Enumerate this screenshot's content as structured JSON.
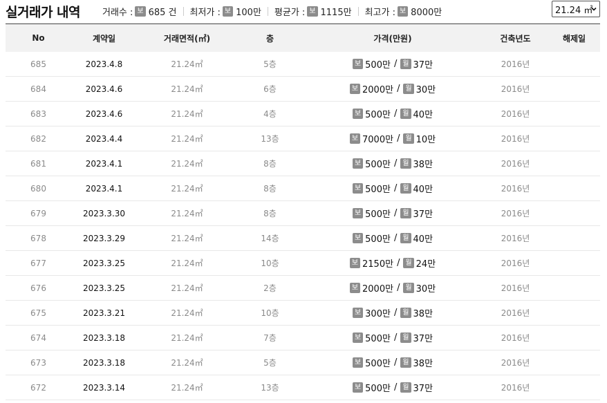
{
  "header": {
    "title": "실거래가 내역",
    "stats": [
      {
        "label": "거래수 :",
        "badge": "보",
        "value": "685 건"
      },
      {
        "label": "최저가 :",
        "badge": "보",
        "value": "100만"
      },
      {
        "label": "평균가 :",
        "badge": "보",
        "value": "1115만"
      },
      {
        "label": "최고가 :",
        "badge": "보",
        "value": "8000만"
      }
    ],
    "area_select": {
      "selected": "21.24 ㎡"
    }
  },
  "table": {
    "columns": [
      "No",
      "계약일",
      "거래면적(㎡)",
      "층",
      "가격(만원)",
      "건축년도",
      "해제일"
    ],
    "deposit_badge": "보",
    "monthly_badge": "월",
    "rows": [
      {
        "no": "685",
        "date": "2023.4.8",
        "area": "21.24㎡",
        "floor": "5층",
        "deposit": "500만",
        "monthly": "37만",
        "year": "2016년",
        "cancel": ""
      },
      {
        "no": "684",
        "date": "2023.4.6",
        "area": "21.24㎡",
        "floor": "6층",
        "deposit": "2000만",
        "monthly": "30만",
        "year": "2016년",
        "cancel": ""
      },
      {
        "no": "683",
        "date": "2023.4.6",
        "area": "21.24㎡",
        "floor": "4층",
        "deposit": "500만",
        "monthly": "40만",
        "year": "2016년",
        "cancel": ""
      },
      {
        "no": "682",
        "date": "2023.4.4",
        "area": "21.24㎡",
        "floor": "13층",
        "deposit": "7000만",
        "monthly": "10만",
        "year": "2016년",
        "cancel": ""
      },
      {
        "no": "681",
        "date": "2023.4.1",
        "area": "21.24㎡",
        "floor": "8층",
        "deposit": "500만",
        "monthly": "38만",
        "year": "2016년",
        "cancel": ""
      },
      {
        "no": "680",
        "date": "2023.4.1",
        "area": "21.24㎡",
        "floor": "8층",
        "deposit": "500만",
        "monthly": "40만",
        "year": "2016년",
        "cancel": ""
      },
      {
        "no": "679",
        "date": "2023.3.30",
        "area": "21.24㎡",
        "floor": "8층",
        "deposit": "500만",
        "monthly": "37만",
        "year": "2016년",
        "cancel": ""
      },
      {
        "no": "678",
        "date": "2023.3.29",
        "area": "21.24㎡",
        "floor": "14층",
        "deposit": "500만",
        "monthly": "40만",
        "year": "2016년",
        "cancel": ""
      },
      {
        "no": "677",
        "date": "2023.3.25",
        "area": "21.24㎡",
        "floor": "10층",
        "deposit": "2150만",
        "monthly": "24만",
        "year": "2016년",
        "cancel": ""
      },
      {
        "no": "676",
        "date": "2023.3.25",
        "area": "21.24㎡",
        "floor": "2층",
        "deposit": "2000만",
        "monthly": "30만",
        "year": "2016년",
        "cancel": ""
      },
      {
        "no": "675",
        "date": "2023.3.21",
        "area": "21.24㎡",
        "floor": "10층",
        "deposit": "300만",
        "monthly": "38만",
        "year": "2016년",
        "cancel": ""
      },
      {
        "no": "674",
        "date": "2023.3.18",
        "area": "21.24㎡",
        "floor": "7층",
        "deposit": "500만",
        "monthly": "37만",
        "year": "2016년",
        "cancel": ""
      },
      {
        "no": "673",
        "date": "2023.3.18",
        "area": "21.24㎡",
        "floor": "5층",
        "deposit": "500만",
        "monthly": "38만",
        "year": "2016년",
        "cancel": ""
      },
      {
        "no": "672",
        "date": "2023.3.14",
        "area": "21.24㎡",
        "floor": "13층",
        "deposit": "500만",
        "monthly": "37만",
        "year": "2016년",
        "cancel": ""
      }
    ]
  }
}
